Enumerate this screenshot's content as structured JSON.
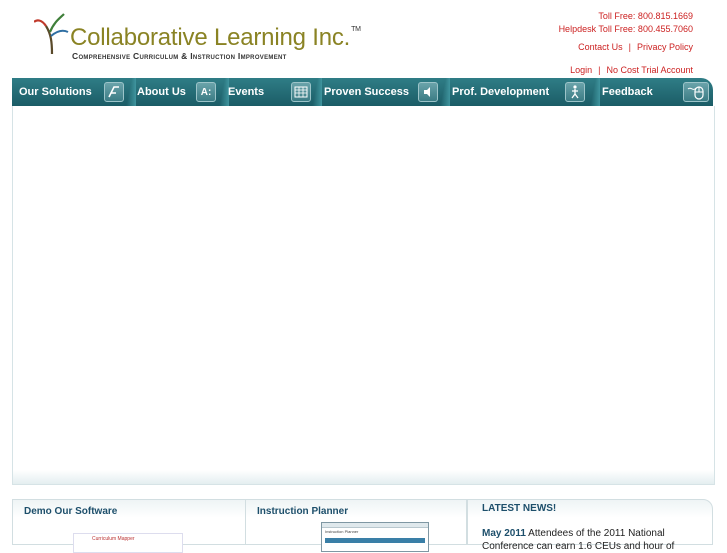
{
  "brand": {
    "name": "Collaborative Learning Inc.",
    "tm": "TM",
    "tagline": "Comprehensive Curriculum & Instruction Improvement",
    "brand_color": "#8a8324"
  },
  "contact": {
    "toll_free": "Toll Free: 800.815.1669",
    "helpdesk": "Helpdesk Toll Free: 800.455.7060"
  },
  "top_links": {
    "contact": "Contact Us",
    "privacy": "Privacy Policy",
    "separator": "|"
  },
  "account_links": {
    "login": "Login",
    "trial": "No Cost Trial Account",
    "separator": "|"
  },
  "nav": {
    "items": [
      {
        "label": "Our Solutions",
        "icon": "teach-icon"
      },
      {
        "label": "About Us",
        "icon": "a-icon"
      },
      {
        "label": "Events",
        "icon": "calendar-icon"
      },
      {
        "label": "Proven Success",
        "icon": "speaker-icon"
      },
      {
        "label": "Prof. Development",
        "icon": "person-icon"
      },
      {
        "label": "Feedback",
        "icon": "mouse-icon"
      }
    ],
    "bg_color": "#1b5c66"
  },
  "panels": {
    "demo": {
      "title": "Demo Our Software",
      "thumb_caption": "Curriculum Mapper"
    },
    "planner": {
      "title": "Instruction Planner",
      "thumb_caption": "Instruction Planner"
    },
    "news": {
      "title": "LATEST NEWS!",
      "date": "May 2011",
      "text": "Attendees of the 2011 National Conference can earn 1.6 CEUs and hour of"
    }
  }
}
